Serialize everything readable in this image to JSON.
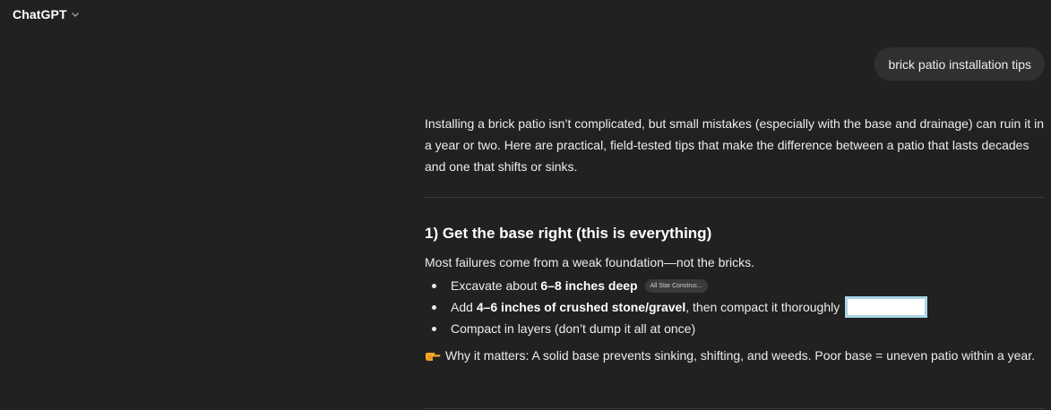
{
  "header": {
    "model_name": "ChatGPT"
  },
  "user_message": {
    "text": "brick patio installation tips"
  },
  "assistant_message": {
    "intro": "Installing a brick patio isn’t complicated, but small mistakes (especially with the base and drainage) can ruin it in a year or two. Here are practical, field-tested tips that make the difference between a patio that lasts decades and one that shifts or sinks.",
    "section1": {
      "heading": "1) Get the base right (this is everything)",
      "lead": "Most failures come from a weak foundation—not the bricks.",
      "bullets": [
        {
          "prefix": "Excavate about ",
          "bold": "6–8 inches deep",
          "suffix": "",
          "source_chip": "All Star Construc..."
        },
        {
          "prefix": "Add ",
          "bold": "4–6 inches of crushed stone/gravel",
          "suffix": ", then compact it thoroughly"
        },
        {
          "text": "Compact in layers (don’t dump it all at once)"
        }
      ],
      "why_icon": "pointing-hand-icon",
      "why_text": "Why it matters: A solid base prevents sinking, shifting, and weeds. Poor base = uneven patio within a year."
    }
  },
  "colors": {
    "background": "#212121",
    "user_bubble": "#303030",
    "text": "#ececec",
    "highlight_border": "#a9d5e6"
  }
}
